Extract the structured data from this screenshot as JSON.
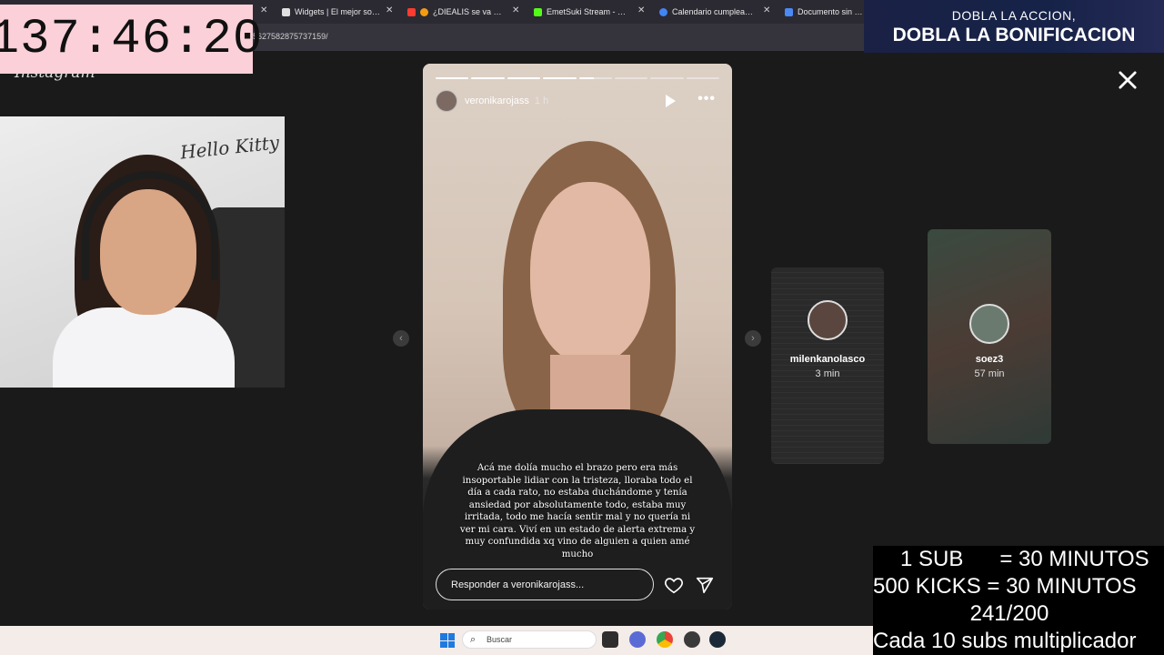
{
  "browser": {
    "tabs": [
      {
        "label": "Widgets | El mejor softwa",
        "color": "#e0e0e0"
      },
      {
        "label": "¿DIEALIS se va a CAN",
        "color": "#ff3b30"
      },
      {
        "label": "EmetSuki Stream - Watch",
        "color": "#53fc18"
      },
      {
        "label": "Calendario cumpleaños",
        "color": "#4285f4"
      },
      {
        "label": "Documento sin títul",
        "color": "#4a8af4"
      }
    ],
    "url": "5627582875737159/"
  },
  "overlay": {
    "timer": "137:46:20",
    "banner_line1": "DOBLA LA ACCION,",
    "banner_line2": "DOBLA LA BONIFICACION",
    "subs_lines": [
      "1 SUB      = 30 MINUTOS",
      "500 KICKS = 30 MINUTOS",
      "241/200",
      "Cada 10 subs multiplicador"
    ]
  },
  "instagram": {
    "logo": "Instagram",
    "webcam_wall_text": "Hello Kitty",
    "story": {
      "username": "veronikarojass",
      "time": "1 h",
      "segments_total": 8,
      "current_segment": 5,
      "current_segment_progress": 0.45,
      "caption": "Acá me dolía mucho el brazo pero era más insoportable lidiar con la tristeza, lloraba todo el día a cada rato, no estaba duchándome y tenía ansiedad por absolutamente todo, estaba muy irritada, todo me hacía sentir mal y no quería ni ver mi cara. Viví en un estado de alerta extrema y muy confundida xq vino de alguien a quien amé mucho",
      "reply_placeholder": "Responder a veronikarojass..."
    },
    "next_stories": [
      {
        "username": "milenkanolasco",
        "time": "3 min"
      },
      {
        "username": "soez3",
        "time": "57 min"
      }
    ]
  },
  "taskbar": {
    "search_placeholder": "Buscar"
  },
  "icons": {
    "close": "close-icon",
    "prev": "chevron-left-icon",
    "next": "chevron-right-icon",
    "play": "play-icon",
    "more": "more-horizontal-icon",
    "heart": "heart-icon",
    "send": "send-icon"
  }
}
